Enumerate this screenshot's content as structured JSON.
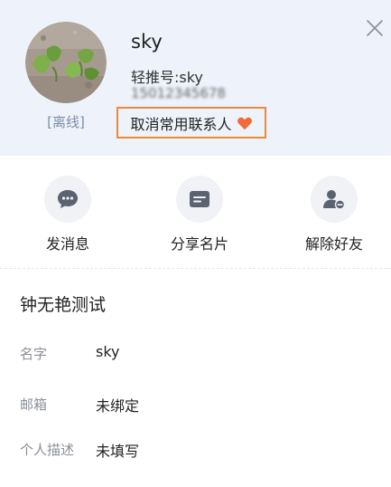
{
  "profile": {
    "name": "sky",
    "account": "轻推号:sky",
    "phone": "15012345678",
    "status": "[离线]",
    "favorite_label": "取消常用联系人"
  },
  "actions": [
    {
      "label": "发消息",
      "icon": "chat-bubble-icon"
    },
    {
      "label": "分享名片",
      "icon": "card-icon"
    },
    {
      "label": "解除好友",
      "icon": "remove-user-icon"
    }
  ],
  "details": {
    "group_title": "钟无艳测试",
    "fields": [
      {
        "label": "名字",
        "value": "sky"
      },
      {
        "label": "邮箱",
        "value": "未绑定"
      },
      {
        "label": "个人描述",
        "value": "未填写"
      }
    ]
  },
  "colors": {
    "header_bg": "#eef3fb",
    "heart": "#f06a3a",
    "highlight_border": "#e98a3a",
    "icon_gray": "#5b6270"
  }
}
